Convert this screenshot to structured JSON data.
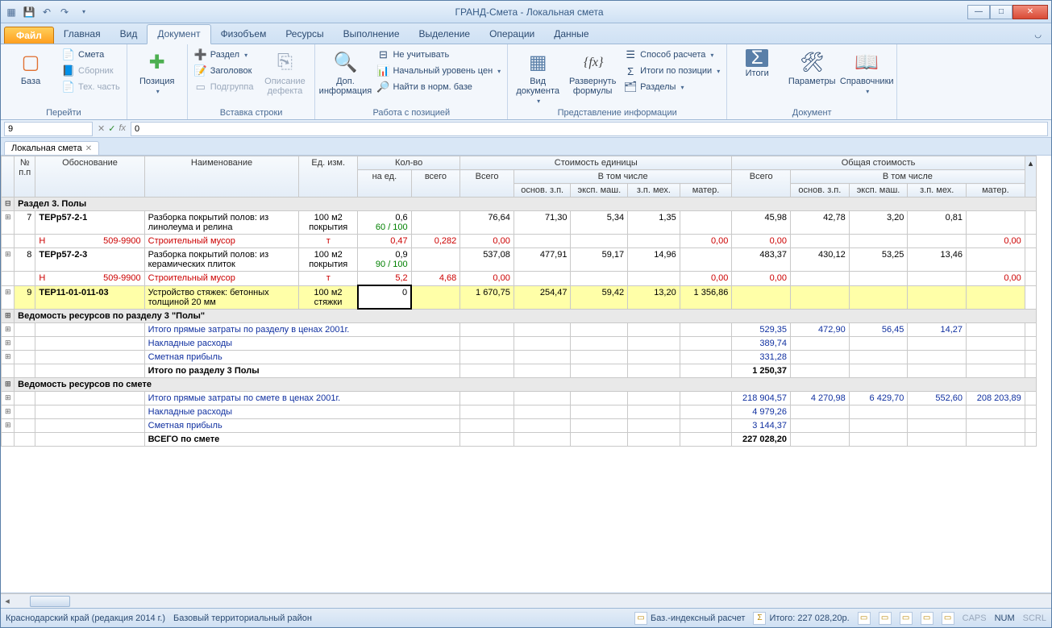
{
  "window": {
    "title": "ГРАНД-Смета - Локальная смета"
  },
  "tabs": {
    "file": "Файл",
    "items": [
      "Главная",
      "Вид",
      "Документ",
      "Физобъем",
      "Ресурсы",
      "Выполнение",
      "Выделение",
      "Операции",
      "Данные"
    ],
    "active": "Документ"
  },
  "ribbon": {
    "g1": {
      "label": "Перейти",
      "big": "База",
      "small": [
        "Смета",
        "Сборник",
        "Тех. часть"
      ]
    },
    "g2": {
      "label": "",
      "big": "Позиция"
    },
    "g3": {
      "label": "Вставка строки",
      "small": [
        "Раздел",
        "Заголовок",
        "Подгруппа"
      ],
      "big": "Описание\nдефекта"
    },
    "g4": {
      "label": "Работа с позицией",
      "big": "Доп.\nинформация",
      "small": [
        "Не учитывать",
        "Начальный уровень цен",
        "Найти в норм. базе"
      ]
    },
    "g5": {
      "label": "Представление информации",
      "big1": "Вид\nдокумента",
      "big2": "Развернуть\nформулы",
      "small": [
        "Способ расчета",
        "Итоги по позиции",
        "Разделы"
      ]
    },
    "g6": {
      "label": "Документ",
      "big1": "Итоги",
      "big2": "Параметры",
      "big3": "Справочники"
    }
  },
  "formula": {
    "cell": "9",
    "value": "0"
  },
  "docTab": "Локальная смета",
  "headers": {
    "npp": "№\nп.п",
    "obosn": "Обоснование",
    "naim": "Наименование",
    "ed": "Ед. изм.",
    "kolvo": "Кол-во",
    "naed": "на ед.",
    "vsego": "всего",
    "sed": "Стоимость единицы",
    "obsh": "Общая стоимость",
    "Vsego": "Всего",
    "vtom": "В том числе",
    "c1": "основ. з.п.",
    "c2": "эксп. маш.",
    "c3": "з.п. мех.",
    "c4": "матер."
  },
  "rows": {
    "sec3": "Раздел 3. Полы",
    "r7": {
      "n": "7",
      "ob": "ТЕРр57-2-1",
      "nm": "Разборка покрытий полов: из линолеума и релина",
      "ed": "100 м2 покрытия",
      "naed": "0,6",
      "naed2": "60 / 100",
      "vs": "76,64",
      "v": "71,30",
      "t1": "5,34",
      "t2": "1,35",
      "ov": "45,98",
      "o1": "42,78",
      "o2": "3,20",
      "o3": "0,81"
    },
    "r7h": {
      "ob": "Н",
      "code": "509-9900",
      "nm": "Строительный мусор",
      "ed": "т",
      "naed": "0,47",
      "vs": "0,282",
      "v": "0,00",
      "ov": "0,00",
      "om": "0,00"
    },
    "r8": {
      "n": "8",
      "ob": "ТЕРр57-2-3",
      "nm": "Разборка покрытий полов: из керамических плиток",
      "ed": "100 м2 покрытия",
      "naed": "0,9",
      "naed2": "90 / 100",
      "vs": "537,08",
      "v": "477,91",
      "t1": "59,17",
      "t2": "14,96",
      "ov": "483,37",
      "o1": "430,12",
      "o2": "53,25",
      "o3": "13,46"
    },
    "r8h": {
      "ob": "Н",
      "code": "509-9900",
      "nm": "Строительный мусор",
      "ed": "т",
      "naed": "5,2",
      "vs": "4,68",
      "v": "0,00",
      "ov": "0,00",
      "om": "0,00"
    },
    "r9": {
      "n": "9",
      "ob": "ТЕР11-01-011-03",
      "nm": "Устройство стяжек: бетонных толщиной 20 мм",
      "ed": "100 м2 стяжки",
      "naed": "0",
      "vs": "1 670,75",
      "v": "254,47",
      "t1": "59,42",
      "t2": "13,20",
      "t3": "1 356,86"
    },
    "ved3": "Ведомость ресурсов по разделу 3 \"Полы\"",
    "l1": {
      "nm": "Итого прямые затраты по разделу в ценах 2001г.",
      "ov": "529,35",
      "o1": "472,90",
      "o2": "56,45",
      "o3": "14,27"
    },
    "l2": {
      "nm": "Накладные расходы",
      "ov": "389,74"
    },
    "l3": {
      "nm": "Сметная прибыль",
      "ov": "331,28"
    },
    "l4": {
      "nm": "Итого по разделу 3 Полы",
      "ov": "1 250,37"
    },
    "vedS": "Ведомость ресурсов по смете",
    "s1": {
      "nm": "Итого прямые затраты по смете в ценах 2001г.",
      "ov": "218 904,57",
      "o1": "4 270,98",
      "o2": "6 429,70",
      "o3": "552,60",
      "o4": "208 203,89"
    },
    "s2": {
      "nm": "Накладные расходы",
      "ov": "4 979,26"
    },
    "s3": {
      "nm": "Сметная прибыль",
      "ov": "3 144,37"
    },
    "s4": {
      "nm": "ВСЕГО по смете",
      "ov": "227 028,20"
    }
  },
  "status": {
    "left1": "Краснодарский край (редакция 2014 г.)",
    "left2": "Базовый территориальный район",
    "calc": "Баз.-индексный расчет",
    "itogo": "Итого: 227 028,20р.",
    "caps": "CAPS",
    "num": "NUM",
    "scrl": "SCRL"
  }
}
